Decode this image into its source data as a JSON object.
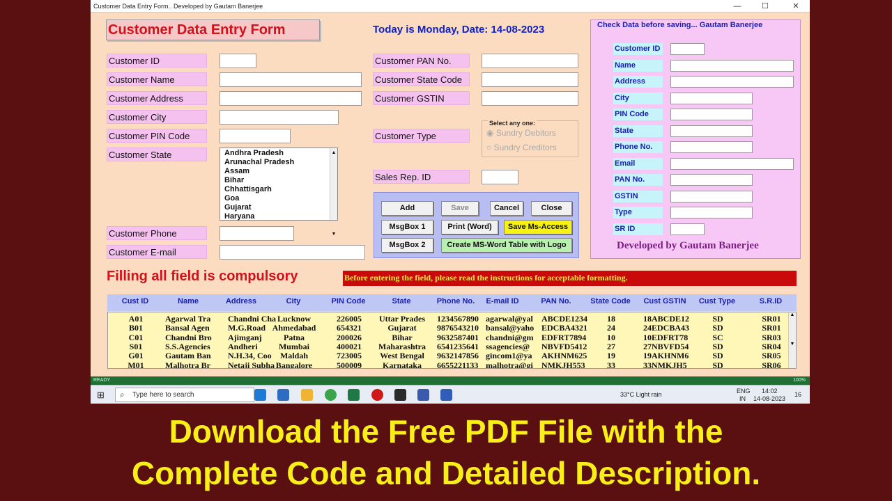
{
  "window": {
    "title": "Customer Data Entry Form.. Developed by Gautam Banerjee",
    "controls": [
      "—",
      "☐",
      "✕"
    ]
  },
  "form": {
    "heading": "Customer Data Entry Form",
    "today": "Today is Monday, Date: 14-08-2023",
    "left_fields": [
      {
        "label": "Customer ID"
      },
      {
        "label": "Customer Name"
      },
      {
        "label": "Customer Address"
      },
      {
        "label": "Customer City"
      },
      {
        "label": "Customer PIN Code"
      },
      {
        "label": "Customer State"
      },
      {
        "label": "Customer Phone"
      },
      {
        "label": "Customer E-mail"
      }
    ],
    "states": [
      "Andhra Pradesh",
      "Arunachal Pradesh",
      "Assam",
      "Bihar",
      "Chhattisgarh",
      "Goa",
      "Gujarat",
      "Haryana"
    ],
    "mid_fields": [
      {
        "label": "Customer PAN No."
      },
      {
        "label": "Customer State Code"
      },
      {
        "label": "Customer GSTIN"
      },
      {
        "label": "Customer Type"
      },
      {
        "label": "Sales Rep. ID"
      }
    ],
    "type_group": {
      "legend": "Select any one:",
      "options": [
        "Sundry Debitors",
        "Sundry Creditors"
      ]
    },
    "buttons": {
      "add": "Add",
      "save": "Save",
      "cancel": "Cancel",
      "close": "Close",
      "msgbox1": "MsgBox 1",
      "print_word": "Print (Word)",
      "save_access": "Save Ms-Access",
      "msgbox2": "MsgBox 2",
      "create_table": "Create MS-Word Table with Logo"
    },
    "compulsory": "Filling all field is compulsory",
    "instructions": "Before entering the field, please read the instructions for acceptable formatting."
  },
  "check_panel": {
    "heading": "Check Data before saving... Gautam Banerjee",
    "labels": [
      "Customer ID",
      "Name",
      "Address",
      "City",
      "PIN Code",
      "State",
      "Phone No.",
      "Email",
      "PAN No.",
      "GSTIN",
      "Type",
      "SR ID"
    ],
    "developed_by": "Developed by Gautam Banerjee"
  },
  "table": {
    "headers": [
      "Cust ID",
      "Name",
      "Address",
      "City",
      "PIN Code",
      "State",
      "Phone No.",
      "E-mail ID",
      "PAN No.",
      "State Code",
      "Cust GSTIN",
      "Cust Type",
      "S.R.ID"
    ],
    "rows": [
      [
        "A01",
        "Agarwal Tra",
        "Chandni Cha",
        "Lucknow",
        "226005",
        "Uttar Prades",
        "1234567890",
        "agarwal@yal",
        "ABCDE1234",
        "18",
        "18ABCDE12",
        "SD",
        "SR01"
      ],
      [
        "B01",
        "Bansal Agen",
        "M.G.Road",
        "Ahmedabad",
        "654321",
        "Gujarat",
        "9876543210",
        "bansal@yaho",
        "EDCBA4321",
        "24",
        "24EDCBA43",
        "SD",
        "SR01"
      ],
      [
        "C01",
        "Chandni Bro",
        "Ajimganj",
        "Patna",
        "200026",
        "Bihar",
        "9632587401",
        "chandni@gm",
        "EDFRT7894",
        "10",
        "10EDFRT78",
        "SC",
        "SR03"
      ],
      [
        "S01",
        "S.S.Agencies",
        "Andheri",
        "Mumbai",
        "400021",
        "Maharashtra",
        "6541235641",
        "ssagencies@",
        "NBVFD5412",
        "27",
        "27NBVFD54",
        "SD",
        "SR04"
      ],
      [
        "G01",
        "Gautam Ban",
        "N.H.34, Coo",
        "Maldah",
        "723005",
        "West Bengal",
        "9632147856",
        "gincom1@ya",
        "AKHNM625",
        "19",
        "19AKHNM6",
        "SD",
        "SR05"
      ],
      [
        "M01",
        "Malhotra Br",
        "Netaji Subha",
        "Bangalore",
        "500009",
        "Karnataka",
        "6655221133",
        "malhotra@gi",
        "NMKJH553",
        "33",
        "33NMKJH5",
        "SD",
        "SR06"
      ]
    ]
  },
  "statusbar": {
    "ready": "READY",
    "zoom": "100%"
  },
  "taskbar": {
    "search_placeholder": "Type here to search",
    "weather": "33°C  Light rain",
    "lang1": "ENG",
    "lang2": "IN",
    "time": "14:02",
    "date": "14-08-2023",
    "notifications": "16"
  },
  "banner": {
    "line1": "Download the Free PDF File with the",
    "line2": "Complete Code and Detailed Description."
  },
  "colors": {
    "background": "#5a0f10",
    "form_bg": "#fbdcc0",
    "banner_text": "#f8ee18"
  }
}
